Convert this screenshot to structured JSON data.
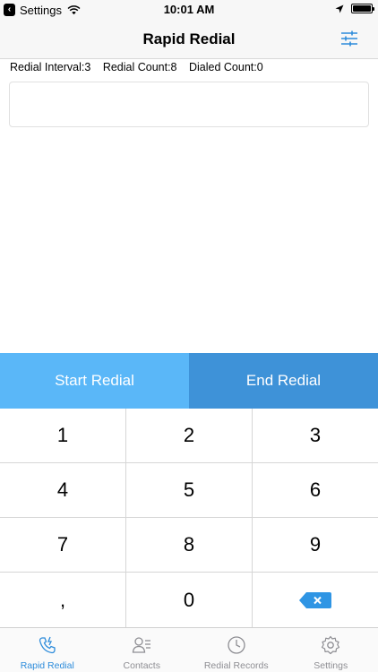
{
  "status_bar": {
    "app": "Settings",
    "time": "10:01 AM"
  },
  "nav": {
    "title": "Rapid Redial"
  },
  "stats": {
    "interval": "Redial Interval:3",
    "count": "Redial Count:8",
    "dialed": "Dialed Count:0"
  },
  "number_input": {
    "value": ""
  },
  "actions": {
    "start": "Start Redial",
    "end": "End Redial"
  },
  "keypad": {
    "keys": [
      "1",
      "2",
      "3",
      "4",
      "5",
      "6",
      "7",
      "8",
      "9",
      ",",
      "0"
    ]
  },
  "tabs": [
    {
      "label": "Rapid Redial",
      "icon": "phone-redial-icon",
      "active": true
    },
    {
      "label": "Contacts",
      "icon": "contacts-icon",
      "active": false
    },
    {
      "label": "Redial Records",
      "icon": "clock-icon",
      "active": false
    },
    {
      "label": "Settings",
      "icon": "gear-icon",
      "active": false
    }
  ],
  "colors": {
    "start_button": "#5ab7f8",
    "end_button": "#3e92d8",
    "accent": "#2d8cdb",
    "delete_key": "#2f95e4"
  }
}
